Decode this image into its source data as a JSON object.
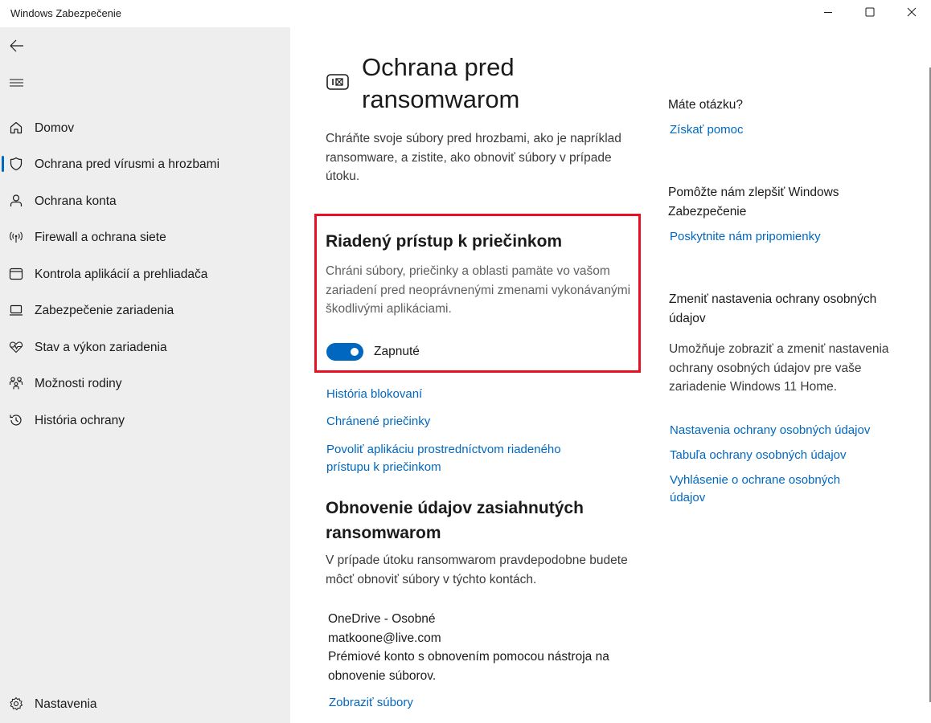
{
  "window": {
    "title": "Windows Zabezpečenie",
    "controls": [
      "minimize-icon",
      "maximize-icon",
      "close-icon"
    ]
  },
  "sidebar": {
    "back_icon": "back-arrow-icon",
    "menu_icon": "hamburger-icon",
    "items": [
      {
        "label": "Domov",
        "icon": "home-icon"
      },
      {
        "label": "Ochrana pred vírusmi a hrozbami",
        "icon": "shield-icon",
        "active": true
      },
      {
        "label": "Ochrana konta",
        "icon": "person-icon"
      },
      {
        "label": "Firewall a ochrana siete",
        "icon": "wifi-antenna-icon"
      },
      {
        "label": "Kontrola aplikácií a prehliadača",
        "icon": "app-window-icon"
      },
      {
        "label": "Zabezpečenie zariadenia",
        "icon": "laptop-icon"
      },
      {
        "label": "Stav a výkon zariadenia",
        "icon": "heart-pulse-icon"
      },
      {
        "label": "Možnosti rodiny",
        "icon": "family-icon"
      },
      {
        "label": "História ochrany",
        "icon": "history-icon"
      }
    ],
    "settings": {
      "label": "Nastavenia",
      "icon": "gear-icon"
    }
  },
  "main": {
    "page_icon": "ransomware-protection-icon",
    "title": "Ochrana pred ransomwarom",
    "description": "Chráňte svoje súbory pred hrozbami, ako je napríklad ransomware, a zistite, ako obnoviť súbory v prípade útoku.",
    "cfa": {
      "title": "Riadený prístup k priečinkom",
      "description": "Chráni súbory, priečinky a oblasti pamäte vo vašom zariadení pred neoprávnenými zmenami vykonávanými škodlivými aplikáciami.",
      "toggle_label": "Zapnuté",
      "toggle_on": true
    },
    "links": {
      "history": "História blokovaní",
      "protected_folders": "Chránené priečinky",
      "allow_app": "Povoliť aplikáciu prostredníctvom riadeného prístupu k priečinkom"
    },
    "recovery": {
      "title": "Obnovenie údajov zasiahnutých ransomwarom",
      "description": "V prípade útoku ransomwarom pravdepodobne budete môcť obnoviť súbory v týchto kontách.",
      "account_name": "OneDrive - Osobné",
      "account_email": "matkoone@live.com",
      "account_info": "Prémiové konto s obnovením pomocou nástroja na obnovenie súborov.",
      "view_files": "Zobraziť súbory"
    }
  },
  "right": {
    "question_head": "Máte otázku?",
    "get_help": "Získať pomoc",
    "improve_head": "Pomôžte nám zlepšiť Windows Zabezpečenie",
    "feedback": "Poskytnite nám pripomienky",
    "privacy_head": "Zmeniť nastavenia ochrany osobných údajov",
    "privacy_text": "Umožňuje zobraziť a zmeniť nastavenia ochrany osobných údajov pre vaše zariadenie Windows 11 Home.",
    "privacy_settings": "Nastavenia ochrany osobných údajov",
    "privacy_dashboard": "Tabuľa ochrany osobných údajov",
    "privacy_statement": "Vyhlásenie o ochrane osobných údajov"
  },
  "colors": {
    "accent": "#0067c0",
    "highlight_border": "#e81123",
    "sidebar_bg": "#eeeeee"
  }
}
